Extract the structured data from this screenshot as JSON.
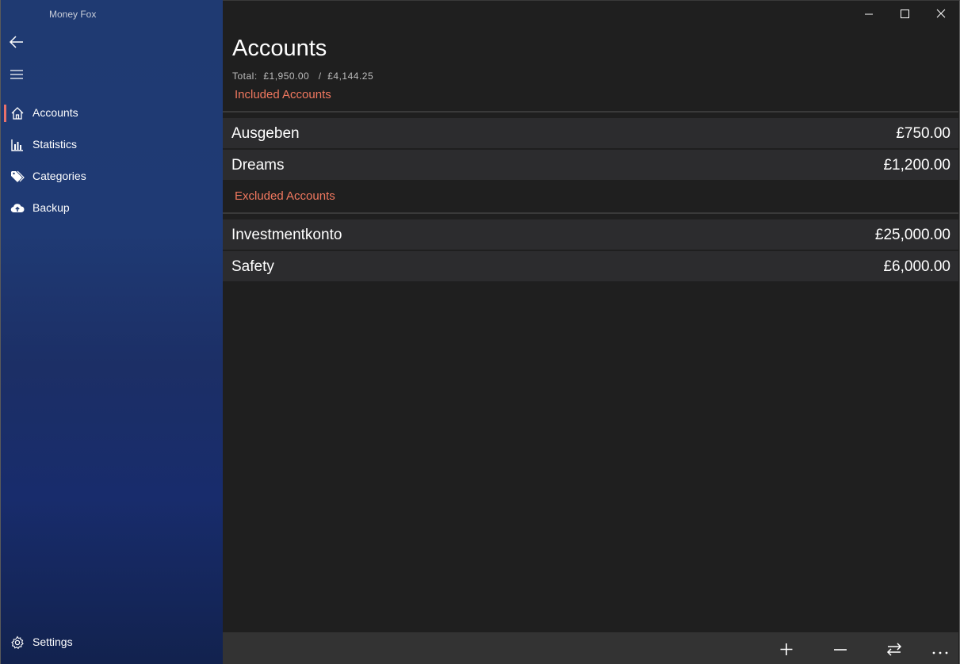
{
  "app": {
    "title": "Money Fox"
  },
  "sidebar": {
    "back_icon": "back-arrow-icon",
    "menu_icon": "hamburger-icon",
    "items": [
      {
        "label": "Accounts",
        "icon": "home-icon",
        "active": true
      },
      {
        "label": "Statistics",
        "icon": "bar-chart-icon",
        "active": false
      },
      {
        "label": "Categories",
        "icon": "tag-icon",
        "active": false
      },
      {
        "label": "Backup",
        "icon": "cloud-upload-icon",
        "active": false
      }
    ],
    "settings": {
      "label": "Settings",
      "icon": "gear-icon"
    }
  },
  "main": {
    "title": "Accounts",
    "totals": "Total:  £1,950.00   /  £4,144.25",
    "included_header": "Included Accounts",
    "excluded_header": "Excluded Accounts",
    "included_accounts": [
      {
        "name": "Ausgeben",
        "value": "£750.00"
      },
      {
        "name": "Dreams",
        "value": "£1,200.00"
      }
    ],
    "excluded_accounts": [
      {
        "name": "Investmentkonto",
        "value": "£25,000.00"
      },
      {
        "name": "Safety",
        "value": "£6,000.00"
      }
    ]
  },
  "command_bar": {
    "buttons": [
      "add-icon",
      "minus-icon",
      "transfer-icon",
      "more-icon"
    ]
  },
  "window_controls": [
    "minimize-icon",
    "maximize-icon",
    "close-icon"
  ],
  "colors": {
    "accent": "#f1785f",
    "active_indicator": "#e8716b",
    "row_background": "#2c2c2e",
    "main_background": "#1f1f1f"
  }
}
